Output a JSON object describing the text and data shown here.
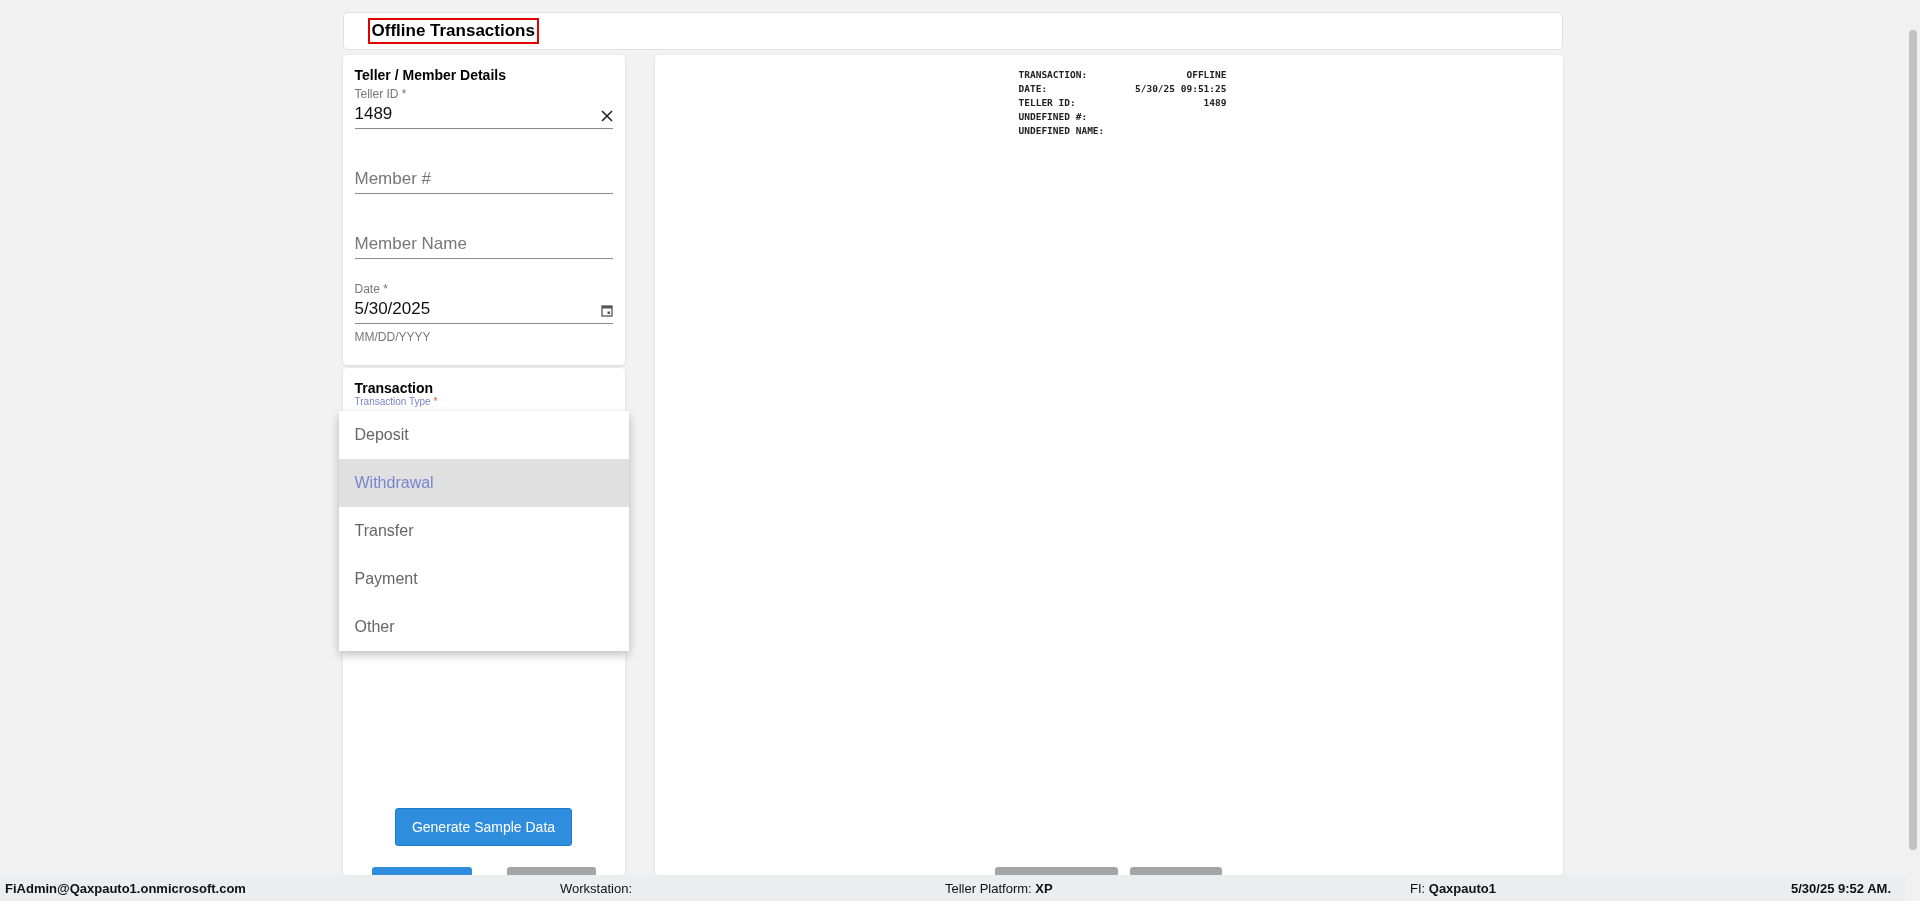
{
  "header": {
    "title": "Offline Transactions"
  },
  "member_details": {
    "title": "Teller / Member Details",
    "fields": [
      {
        "kind": "text",
        "label": "Teller ID",
        "required_mark": "*",
        "value": "1489",
        "clearable": true
      },
      {
        "kind": "text",
        "placeholder": "Member #"
      },
      {
        "kind": "text",
        "placeholder": "Member Name"
      },
      {
        "kind": "text",
        "label": "Date",
        "required_mark": "*",
        "value": "5/30/2025",
        "date_picker": true,
        "helper": "MM/DD/YYYY"
      }
    ]
  },
  "transaction": {
    "title": "Transaction",
    "type_field": {
      "label": "Transaction Type",
      "required_mark": "*",
      "focused": true
    },
    "menu": [
      {
        "label": "Deposit",
        "selected": false
      },
      {
        "label": "Withdrawal",
        "selected": true
      },
      {
        "label": "Transfer",
        "selected": false
      },
      {
        "label": "Payment",
        "selected": false
      },
      {
        "label": "Other",
        "selected": false
      }
    ],
    "sample_button": "Generate Sample Data"
  },
  "receipt": {
    "lines": [
      {
        "label": "TRANSACTION:",
        "value": "OFFLINE"
      },
      {
        "label": "DATE:",
        "value": "5/30/25 09:51:25"
      },
      {
        "label": "TELLER ID:",
        "value": "1489"
      },
      {
        "label": "UNDEFINED #:"
      },
      {
        "label": "UNDEFINED NAME:"
      }
    ]
  },
  "status_bar": {
    "user": "FiAdmin@Qaxpauto1.onmicrosoft.com",
    "workstation": "Workstation:",
    "platform": "Teller Platform: **XP**",
    "fi": "FI: **Qaxpauto1**",
    "time": "5/30/25 9:52 AM."
  }
}
